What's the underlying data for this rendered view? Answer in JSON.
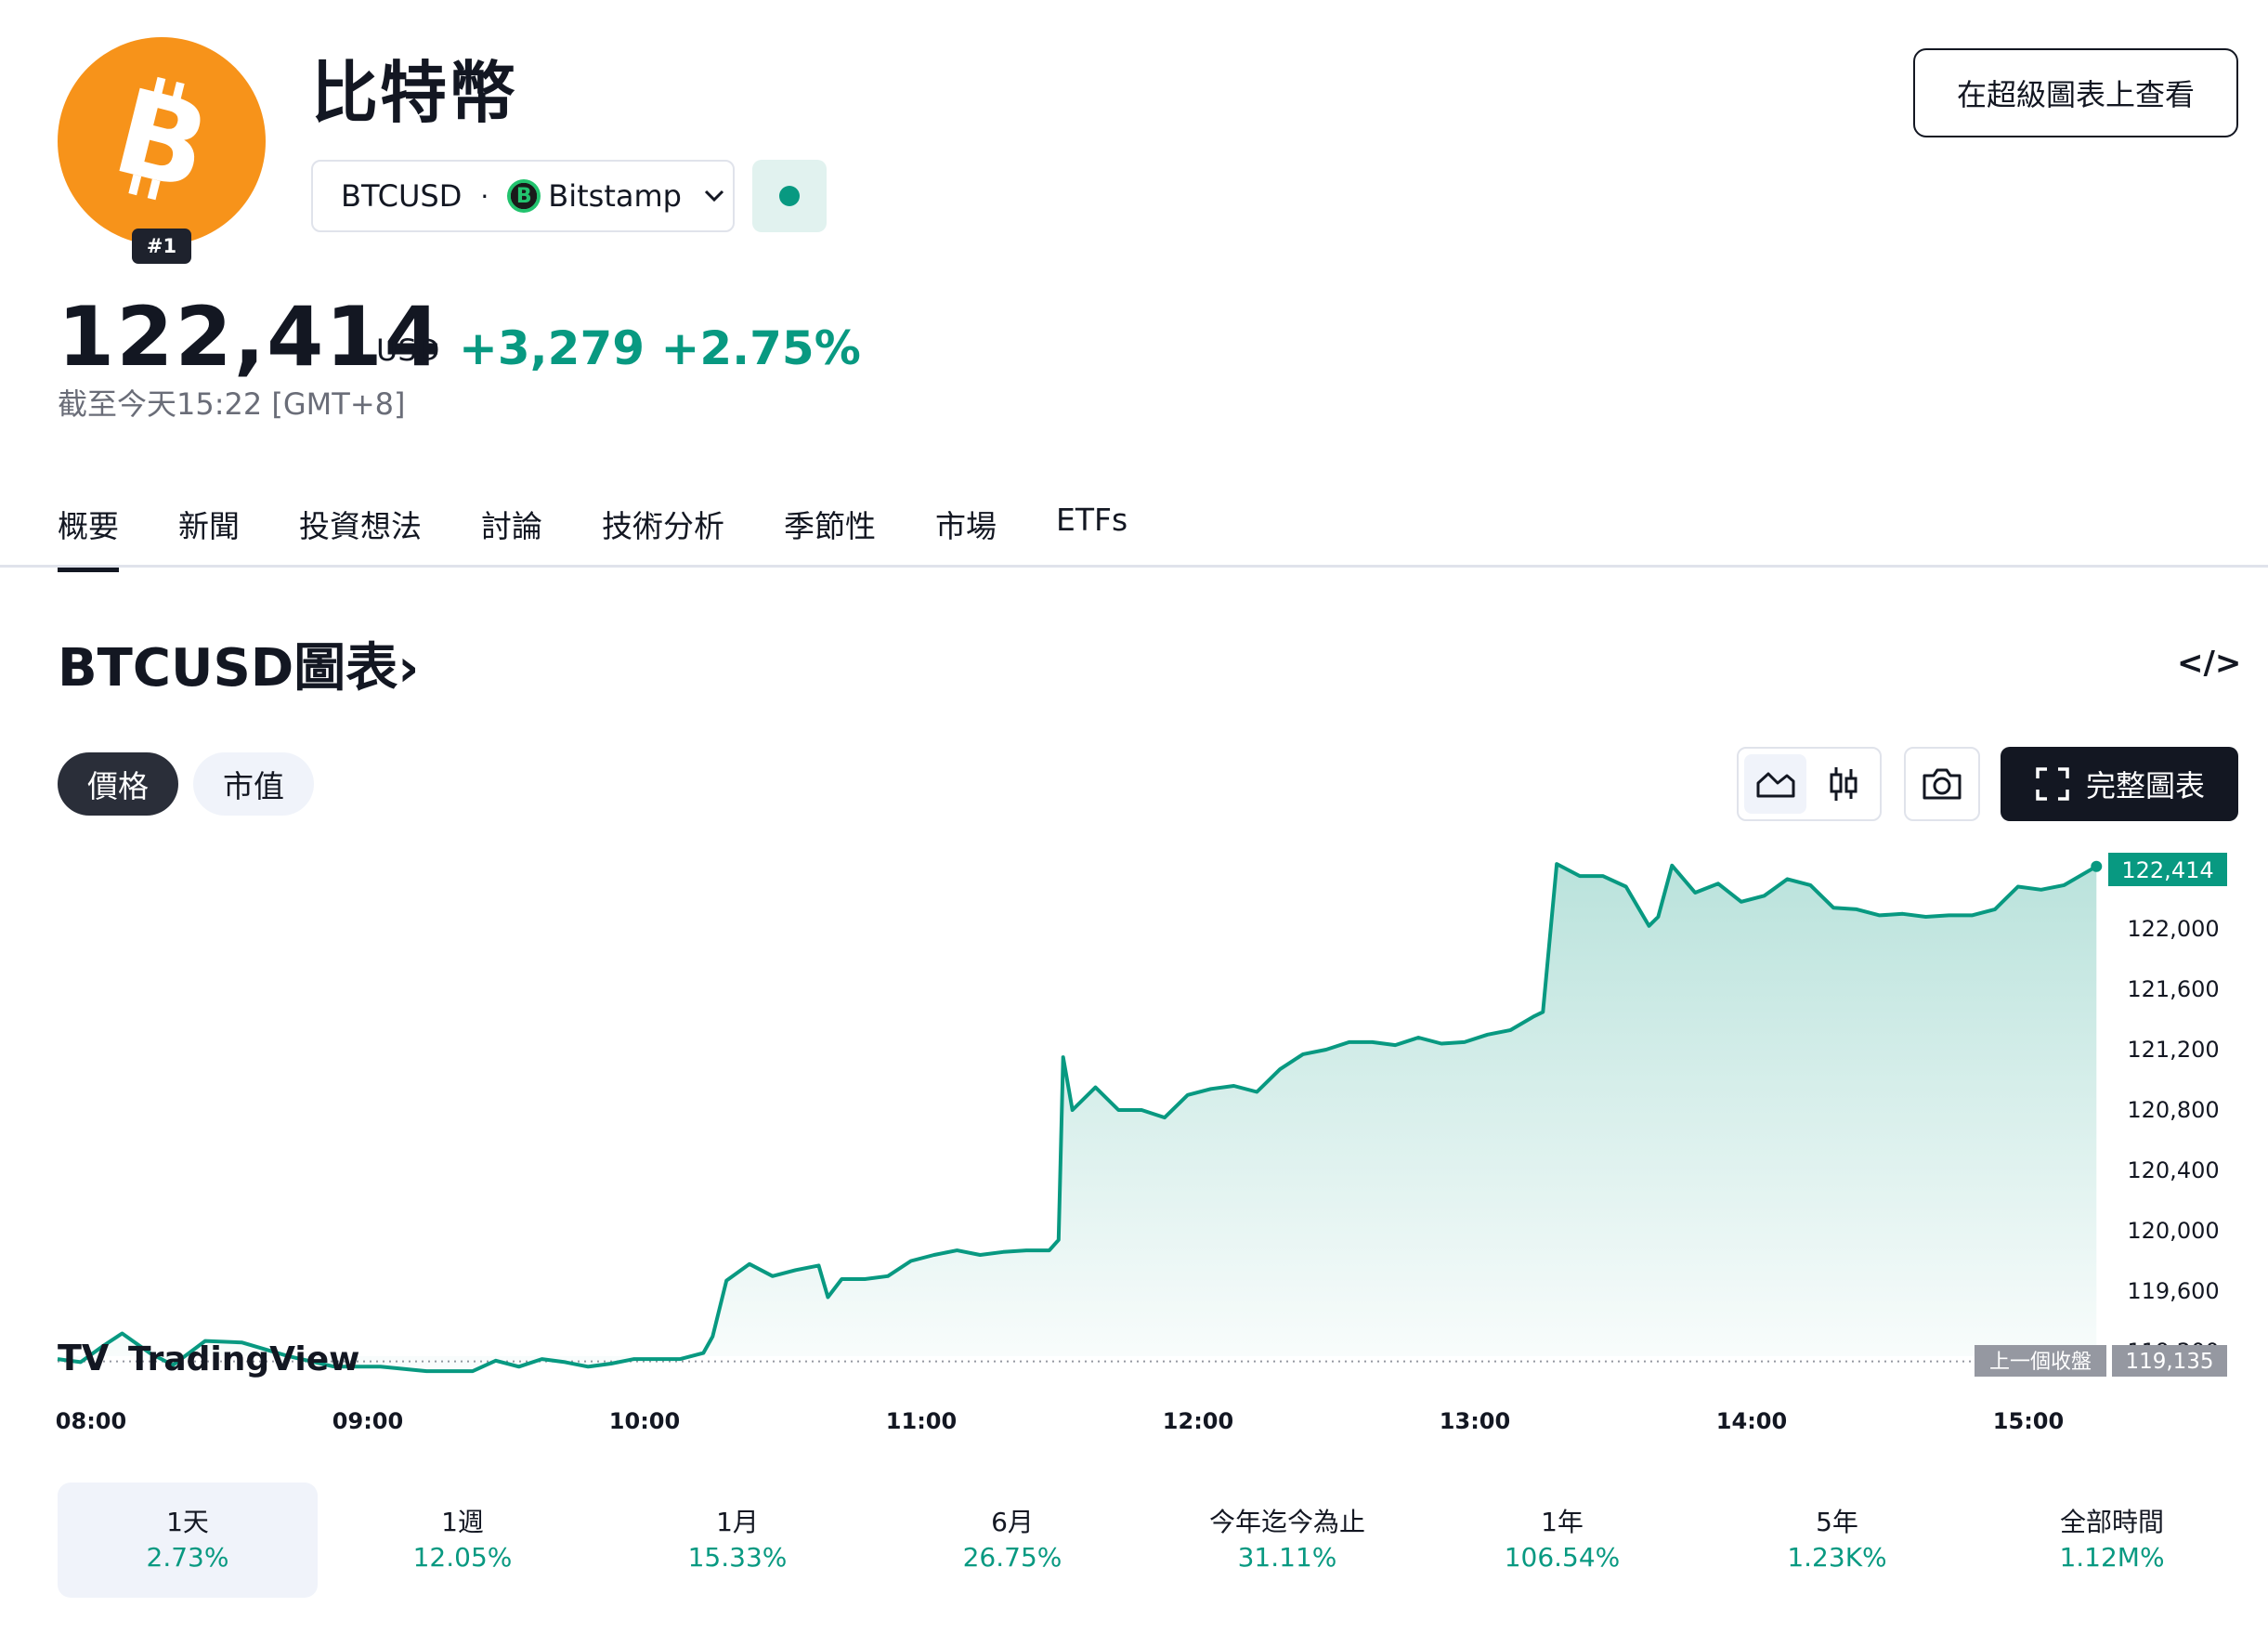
{
  "header": {
    "rank": "#1",
    "title": "比特幣",
    "symbol": "BTCUSD",
    "separator": "·",
    "exchange": "Bitstamp",
    "exchange_icon_letter": "B",
    "super_chart_button": "在超級圖表上查看",
    "price": "122,414",
    "currency": "USD",
    "change": "+3,279 +2.75%",
    "as_of": "截至今天15:22 [GMT+8]",
    "accent_color": "#089981",
    "brand_color": "#f7931a"
  },
  "tabs": [
    "概要",
    "新聞",
    "投資想法",
    "討論",
    "技術分析",
    "季節性",
    "市場",
    "ETFs"
  ],
  "chart_section": {
    "title": "BTCUSD圖表",
    "title_chevron": "›",
    "embed_icon": "</>",
    "toggles": [
      "價格",
      "市值"
    ],
    "full_chart_button": "完整圖表",
    "watermark": "TradingView",
    "prev_close_label": "上一個收盤",
    "prev_close_value": "119,135",
    "last_price_tag": "122,414"
  },
  "chart_data": {
    "type": "area",
    "x_labels": [
      "08:00",
      "09:00",
      "10:00",
      "11:00",
      "12:00",
      "13:00",
      "14:00",
      "15:00"
    ],
    "y_ticks": [
      122000,
      121600,
      121200,
      120800,
      120400,
      120000,
      119600,
      119200
    ],
    "y_tick_labels": [
      "122,000",
      "121,600",
      "121,200",
      "120,800",
      "120,400",
      "120,000",
      "119,600",
      "119,200"
    ],
    "ylim": [
      119000,
      122600
    ],
    "prev_close": 119135,
    "last": 122414,
    "x": [
      "08:00",
      "08:05",
      "08:10",
      "08:14",
      "08:20",
      "08:25",
      "08:32",
      "08:40",
      "08:50",
      "09:00",
      "09:10",
      "09:20",
      "09:30",
      "09:35",
      "09:40",
      "09:45",
      "09:50",
      "09:55",
      "10:00",
      "10:05",
      "10:10",
      "10:15",
      "10:20",
      "10:22",
      "10:25",
      "10:30",
      "10:35",
      "10:40",
      "10:45",
      "10:47",
      "10:50",
      "10:55",
      "11:00",
      "11:05",
      "11:10",
      "11:15",
      "11:20",
      "11:25",
      "11:30",
      "11:35",
      "11:37",
      "11:38",
      "11:40",
      "11:45",
      "11:50",
      "11:55",
      "12:00",
      "12:05",
      "12:10",
      "12:15",
      "12:20",
      "12:25",
      "12:30",
      "12:35",
      "12:40",
      "12:45",
      "12:50",
      "12:55",
      "13:00",
      "13:05",
      "13:10",
      "13:15",
      "13:20",
      "13:22",
      "13:25",
      "13:30",
      "13:35",
      "13:40",
      "13:45",
      "13:47",
      "13:50",
      "13:55",
      "14:00",
      "14:05",
      "14:10",
      "14:15",
      "14:20",
      "14:25",
      "14:30",
      "14:35",
      "14:40",
      "14:45",
      "14:50",
      "14:55",
      "15:00",
      "15:05",
      "15:10",
      "15:15",
      "15:22"
    ],
    "series": [
      {
        "values": [
          119150,
          119130,
          119240,
          119320,
          119190,
          119110,
          119270,
          119260,
          119170,
          119100,
          119100,
          119070,
          119070,
          119140,
          119100,
          119150,
          119130,
          119100,
          119120,
          119150,
          119150,
          119150,
          119190,
          119300,
          119670,
          119780,
          119700,
          119740,
          119770,
          119560,
          119680,
          119680,
          119700,
          119800,
          119840,
          119870,
          119840,
          119860,
          119870,
          119870,
          119940,
          121150,
          120800,
          120950,
          120800,
          120800,
          120750,
          120900,
          120940,
          120960,
          120920,
          121070,
          121170,
          121200,
          121250,
          121250,
          121230,
          121280,
          121240,
          121250,
          121300,
          121330,
          121420,
          121450,
          122430,
          122350,
          122350,
          122280,
          122020,
          122080,
          122420,
          122240,
          122300,
          122180,
          122220,
          122330,
          122290,
          122140,
          122130,
          122090,
          122100,
          122080,
          122090,
          122090,
          122130,
          122280,
          122260,
          122290,
          122414
        ]
      }
    ]
  },
  "periods": [
    {
      "label": "1天",
      "value": "2.73%"
    },
    {
      "label": "1週",
      "value": "12.05%"
    },
    {
      "label": "1月",
      "value": "15.33%"
    },
    {
      "label": "6月",
      "value": "26.75%"
    },
    {
      "label": "今年迄今為止",
      "value": "31.11%"
    },
    {
      "label": "1年",
      "value": "106.54%"
    },
    {
      "label": "5年",
      "value": "1.23K%"
    },
    {
      "label": "全部時間",
      "value": "1.12M%"
    }
  ]
}
